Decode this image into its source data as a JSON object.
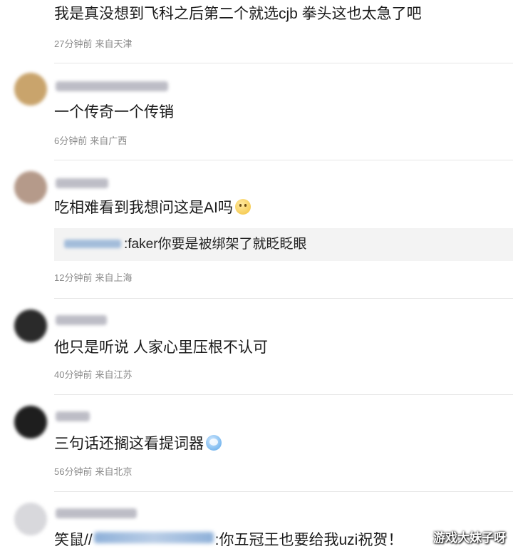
{
  "comments": [
    {
      "text": "我是真没想到飞科之后第二个就选cjb 拳头这也太急了吧",
      "time": "27分钟前",
      "location": "来自天津"
    },
    {
      "text": "一个传奇一个传销",
      "time": "6分钟前",
      "location": "来自广西",
      "avatar_color": "#c9a46c"
    },
    {
      "text": "吃相难看到我想问这是AI吗",
      "emoji": "smile-emoji",
      "reply": ":faker你要是被绑架了就眨眨眼",
      "time": "12分钟前",
      "location": "来自上海",
      "avatar_color": "#b59a8a"
    },
    {
      "text": "他只是听说 人家心里压根不认可",
      "time": "40分钟前",
      "location": "来自江苏",
      "avatar_color": "#2a2a2a"
    },
    {
      "text": "三句话还搁这看提词器",
      "emoji": "crying-laugh-emoji",
      "time": "56分钟前",
      "location": "来自北京",
      "avatar_color": "#1e1e1e"
    },
    {
      "text_prefix": "笑鼠//",
      "text_suffix": ":你五冠王也要给我uzi祝贺！",
      "avatar_color": "#d8d8dc"
    }
  ],
  "watermark": "游戏大妹子呀"
}
